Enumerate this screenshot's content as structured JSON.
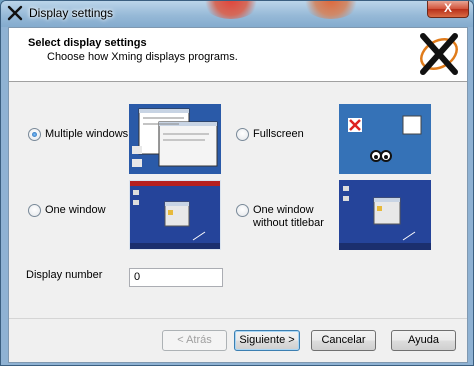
{
  "window": {
    "title": "Display settings",
    "close_glyph": "X"
  },
  "header": {
    "title": "Select display settings",
    "subtitle": "Choose how Xming displays programs.",
    "logo_icon": "xming-logo"
  },
  "options": [
    {
      "label": "Multiple windows",
      "selected": true
    },
    {
      "label": "Fullscreen",
      "selected": false
    },
    {
      "label": "One window",
      "selected": false
    },
    {
      "label": "One window without titlebar",
      "selected": false
    }
  ],
  "display_number": {
    "label": "Display number",
    "value": "0"
  },
  "buttons": {
    "back": "< Atrás",
    "next": "Siguiente >",
    "cancel": "Cancelar",
    "help": "Ayuda"
  },
  "colors": {
    "accent": "#3c7fb1",
    "desktop": "#1f3f8c",
    "selected_radio": "#1d5fa8"
  }
}
